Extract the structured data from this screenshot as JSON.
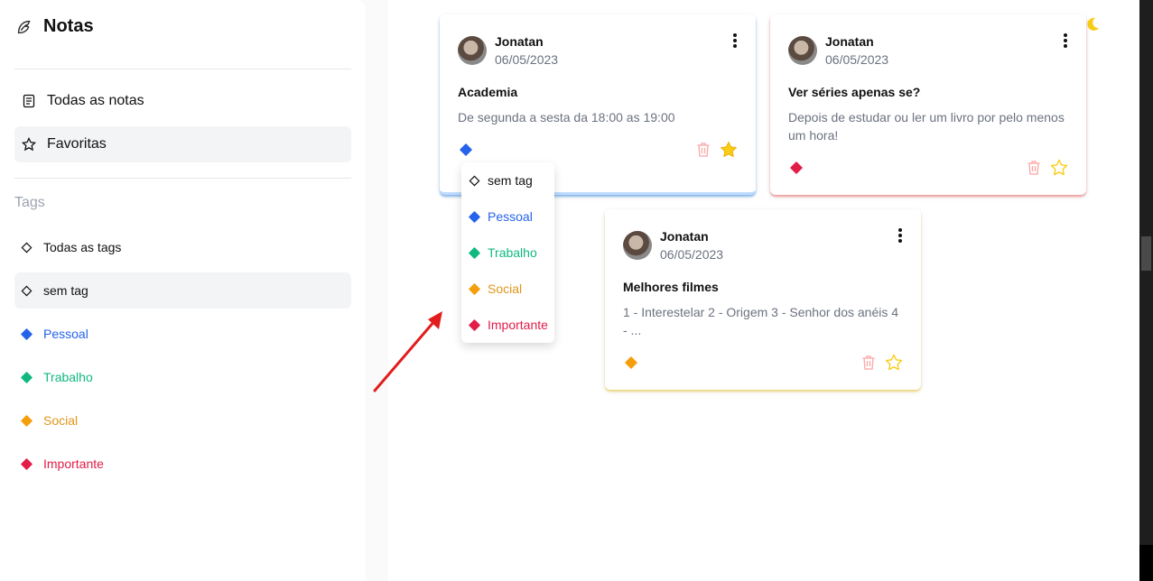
{
  "app": {
    "title": "Notas"
  },
  "nav": {
    "items": [
      {
        "label": "Todas as notas",
        "icon": "document-icon"
      },
      {
        "label": "Favoritas",
        "icon": "star-icon"
      }
    ]
  },
  "tags": {
    "heading": "Tags",
    "items": [
      {
        "label": "Todas as tags",
        "color": "#111827"
      },
      {
        "label": "sem tag",
        "color": "#111827"
      },
      {
        "label": "Pessoal",
        "color": "#2563eb"
      },
      {
        "label": "Trabalho",
        "color": "#10b981"
      },
      {
        "label": "Social",
        "color": "#f59e0b"
      },
      {
        "label": "Importante",
        "color": "#e11d48"
      }
    ]
  },
  "notes": [
    {
      "author": "Jonatan",
      "date": "06/05/2023",
      "title": "Academia",
      "body": "De segunda a sesta da 18:00 as 19:00",
      "tag_color": "#2563eb",
      "favorite": true
    },
    {
      "author": "Jonatan",
      "date": "06/05/2023",
      "title": "Ver séries apenas se?",
      "body": "Depois de estudar ou ler um livro por pelo menos um hora!",
      "tag_color": "#e11d48",
      "favorite": false
    },
    {
      "author": "Jonatan",
      "date": "06/05/2023",
      "title": "Melhores filmes",
      "body": "1 - Interestelar 2 - Origem 3 - Senhor dos anéis 4 - ...",
      "tag_color": "#f59e0b",
      "favorite": false
    }
  ],
  "tag_menu": {
    "items": [
      {
        "label": "sem tag",
        "color": "#111827"
      },
      {
        "label": "Pessoal",
        "color": "#2563eb"
      },
      {
        "label": "Trabalho",
        "color": "#10b981"
      },
      {
        "label": "Social",
        "color": "#f59e0b"
      },
      {
        "label": "Importante",
        "color": "#e11d48"
      }
    ]
  },
  "colors": {
    "annotation_arrow": "#e11d1d",
    "favorite_star": "#facc15",
    "trash": "#fca5a5"
  }
}
